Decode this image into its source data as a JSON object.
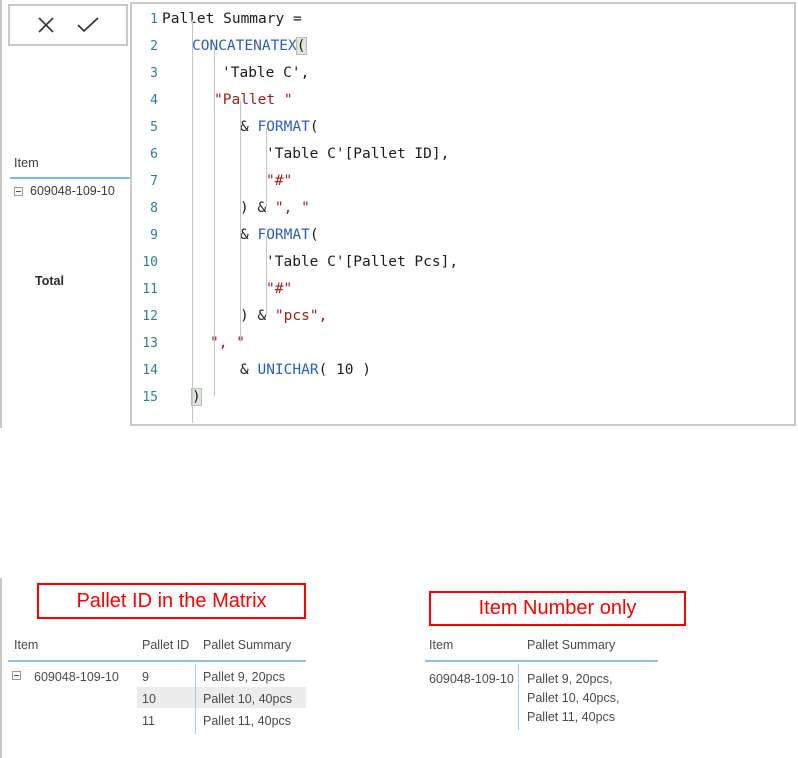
{
  "formula_bar": {
    "cancel_label": "cancel-formula",
    "commit_label": "commit-formula",
    "icons": [
      "close-icon",
      "check-icon"
    ]
  },
  "editor": {
    "measure_name": "Pallet Summary",
    "total_lines": 15,
    "line_numbers": [
      "1",
      "2",
      "3",
      "4",
      "5",
      "6",
      "7",
      "8",
      "9",
      "10",
      "11",
      "12",
      "13",
      "14",
      "15"
    ],
    "colors": {
      "function": "#2b5eb8",
      "string": "#a02020",
      "plain": "#1c1c1c",
      "line_number": "#2e7d99",
      "indent_guide": "#c4c4c4",
      "brace_match_bg": "#dfe6dc",
      "panel_border": "#c9c9c9"
    },
    "lines": [
      {
        "n": "1",
        "indent": 0,
        "tokens": [
          {
            "t": "Pallet Summary =",
            "c": "plain"
          }
        ]
      },
      {
        "n": "2",
        "indent": 30,
        "tokens": [
          {
            "t": "CONCATENATEX",
            "c": "fn"
          },
          {
            "t": "(",
            "c": "brace-hl"
          }
        ]
      },
      {
        "n": "3",
        "indent": 60,
        "tokens": [
          {
            "t": "'Table C',",
            "c": "plain"
          }
        ]
      },
      {
        "n": "4",
        "indent": 52,
        "tokens": [
          {
            "t": "\"Pallet \"",
            "c": "str"
          }
        ]
      },
      {
        "n": "5",
        "indent": 78,
        "tokens": [
          {
            "t": "& ",
            "c": "plain"
          },
          {
            "t": "FORMAT",
            "c": "fn"
          },
          {
            "t": "(",
            "c": "plain"
          }
        ]
      },
      {
        "n": "6",
        "indent": 104,
        "tokens": [
          {
            "t": "'Table C'[Pallet ID],",
            "c": "plain"
          }
        ]
      },
      {
        "n": "7",
        "indent": 104,
        "tokens": [
          {
            "t": "\"#\"",
            "c": "str"
          }
        ]
      },
      {
        "n": "8",
        "indent": 78,
        "tokens": [
          {
            "t": ") & ",
            "c": "plain"
          },
          {
            "t": "\", \"",
            "c": "str"
          }
        ]
      },
      {
        "n": "9",
        "indent": 78,
        "tokens": [
          {
            "t": "& ",
            "c": "plain"
          },
          {
            "t": "FORMAT",
            "c": "fn"
          },
          {
            "t": "(",
            "c": "plain"
          }
        ]
      },
      {
        "n": "10",
        "indent": 104,
        "tokens": [
          {
            "t": "'Table C'[Pallet Pcs],",
            "c": "plain"
          }
        ]
      },
      {
        "n": "11",
        "indent": 104,
        "tokens": [
          {
            "t": "\"#\"",
            "c": "str"
          }
        ]
      },
      {
        "n": "12",
        "indent": 78,
        "tokens": [
          {
            "t": ") & ",
            "c": "plain"
          },
          {
            "t": "\"pcs\",",
            "c": "str"
          }
        ]
      },
      {
        "n": "13",
        "indent": 48,
        "tokens": [
          {
            "t": "\", \"",
            "c": "str"
          }
        ]
      },
      {
        "n": "14",
        "indent": 78,
        "tokens": [
          {
            "t": "& ",
            "c": "plain"
          },
          {
            "t": "UNICHAR",
            "c": "fn"
          },
          {
            "t": "( 10 )",
            "c": "plain"
          }
        ]
      },
      {
        "n": "15",
        "indent": 30,
        "tokens": [
          {
            "t": ")",
            "c": "brace-hl"
          }
        ]
      }
    ]
  },
  "matrix_top_left": {
    "column_header": "Item",
    "row_value": "609048-109-10",
    "total_label": "Total"
  },
  "callouts": {
    "left": "Pallet ID in the Matrix",
    "right": "Item Number only",
    "color": "#ff0000"
  },
  "matrix_with_pallet_id": {
    "headers": [
      "Item",
      "Pallet ID",
      "Pallet Summary"
    ],
    "rows": [
      {
        "item": "609048-109-10",
        "pallet_id": "9",
        "pallet_summary": "Pallet 9, 20pcs",
        "highlighted": false
      },
      {
        "item": "",
        "pallet_id": "10",
        "pallet_summary": "Pallet 10, 40pcs",
        "highlighted": true
      },
      {
        "item": "",
        "pallet_id": "11",
        "pallet_summary": "Pallet 11, 40pcs",
        "highlighted": false
      }
    ]
  },
  "matrix_item_only": {
    "headers": [
      "Item",
      "Pallet Summary"
    ],
    "rows": [
      {
        "item": "609048-109-10",
        "pallet_summary_lines": [
          "Pallet 9, 20pcs,",
          "Pallet 10, 40pcs,",
          "Pallet 11, 40pcs"
        ]
      }
    ]
  }
}
